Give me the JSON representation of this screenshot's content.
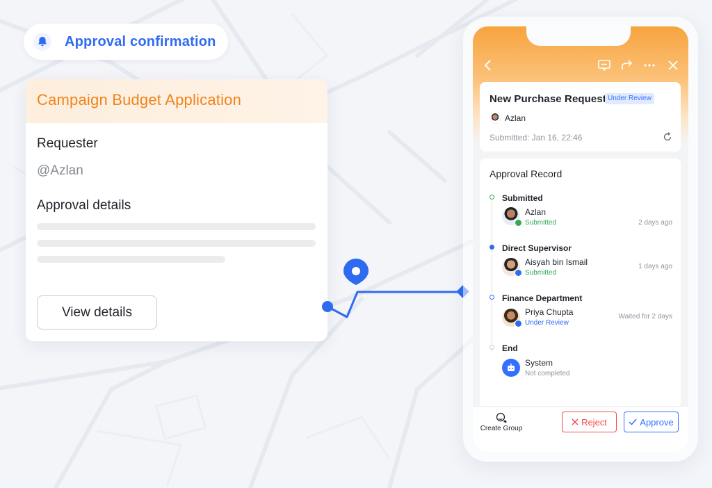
{
  "notification": {
    "title": "Approval confirmation"
  },
  "budget_card": {
    "title": "Campaign Budget Application",
    "requester_label": "Requester",
    "requester_value": "@Azlan",
    "details_label": "Approval details",
    "view_button": "View details"
  },
  "phone": {
    "request": {
      "title": "New Purchase Request",
      "badge": "Under Review",
      "requester": "Azlan",
      "submitted": "Submitted: Jan 16, 22:46"
    },
    "record": {
      "title": "Approval Record",
      "steps": [
        {
          "name": "Submitted",
          "person": "Azlan",
          "status": "Submitted",
          "time": "2 days ago"
        },
        {
          "name": "Direct Supervisor",
          "person": "Aisyah bin Ismail",
          "status": "Submitted",
          "time": "1 days ago"
        },
        {
          "name": "Finance Department",
          "person": "Priya Chupta",
          "status": "Under Review",
          "time": "Waited for 2 days"
        },
        {
          "name": "End",
          "person": "System",
          "status": "Not completed",
          "time": ""
        }
      ]
    },
    "footer": {
      "create_group": "Create Group",
      "reject": "Reject",
      "approve": "Approve"
    }
  },
  "colors": {
    "accent_blue": "#2f6bf0",
    "accent_orange": "#f0831a",
    "status_green": "#34a853",
    "reject_red": "#f04c4c"
  },
  "icons": [
    "bell-icon",
    "location-pin-icon",
    "back-icon",
    "comment-icon",
    "share-icon",
    "more-icon",
    "close-icon",
    "refresh-icon",
    "robot-icon",
    "create-group-icon"
  ]
}
